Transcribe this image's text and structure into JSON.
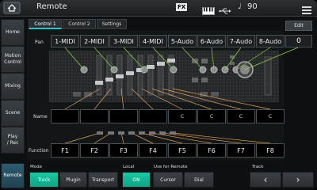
{
  "header": {
    "title": "Remote",
    "fx_label": "FX",
    "note_glyph": "♩",
    "tempo": "90"
  },
  "sidebar": {
    "items": [
      {
        "label": "Home",
        "active": false
      },
      {
        "label": "Motion\nControl",
        "active": false
      },
      {
        "label": "Mixing",
        "active": false
      },
      {
        "label": "Scene",
        "active": false
      },
      {
        "label": "Play\n/ Rec",
        "active": false
      },
      {
        "label": "Remote",
        "active": true
      }
    ]
  },
  "tabs": [
    {
      "label": "Control 1",
      "active": true
    },
    {
      "label": "Control 2",
      "active": false
    },
    {
      "label": "Settings",
      "active": false
    }
  ],
  "edit_label": "Edit",
  "pan": {
    "label": "Pan",
    "buttons": [
      "1-MIDI",
      "2-MIDI",
      "3-MIDI",
      "4-MIDI",
      "5-Audo",
      "6-Audo",
      "7-Audo",
      "8-Audo"
    ],
    "value": "0"
  },
  "name_row": {
    "label": "Name",
    "cells": [
      "",
      "",
      "",
      "",
      "C",
      "C",
      "C",
      "C"
    ]
  },
  "function_row": {
    "label": "Function",
    "buttons": [
      "F1",
      "F2",
      "F3",
      "F4",
      "F5",
      "F6",
      "F7",
      "F8"
    ]
  },
  "bottom": {
    "mode_label": "Mode",
    "mode_buttons": [
      {
        "label": "Track",
        "on": true
      },
      {
        "label": "Plugin",
        "on": false
      },
      {
        "label": "Transport",
        "on": false
      }
    ],
    "local_label": "Local",
    "local_value": "ON",
    "use_label": "Use for Remote",
    "use_buttons": [
      "Cursor",
      "Dial"
    ],
    "track_label": "Track",
    "prev_glyph": "‹",
    "next_glyph": "›"
  },
  "colors": {
    "accent": "#2dc9c7",
    "on_green": "#17c9a3",
    "pan_lines": "#8fd13f",
    "name_lines": "#e6a35a",
    "func_lines": "#e0a050"
  }
}
